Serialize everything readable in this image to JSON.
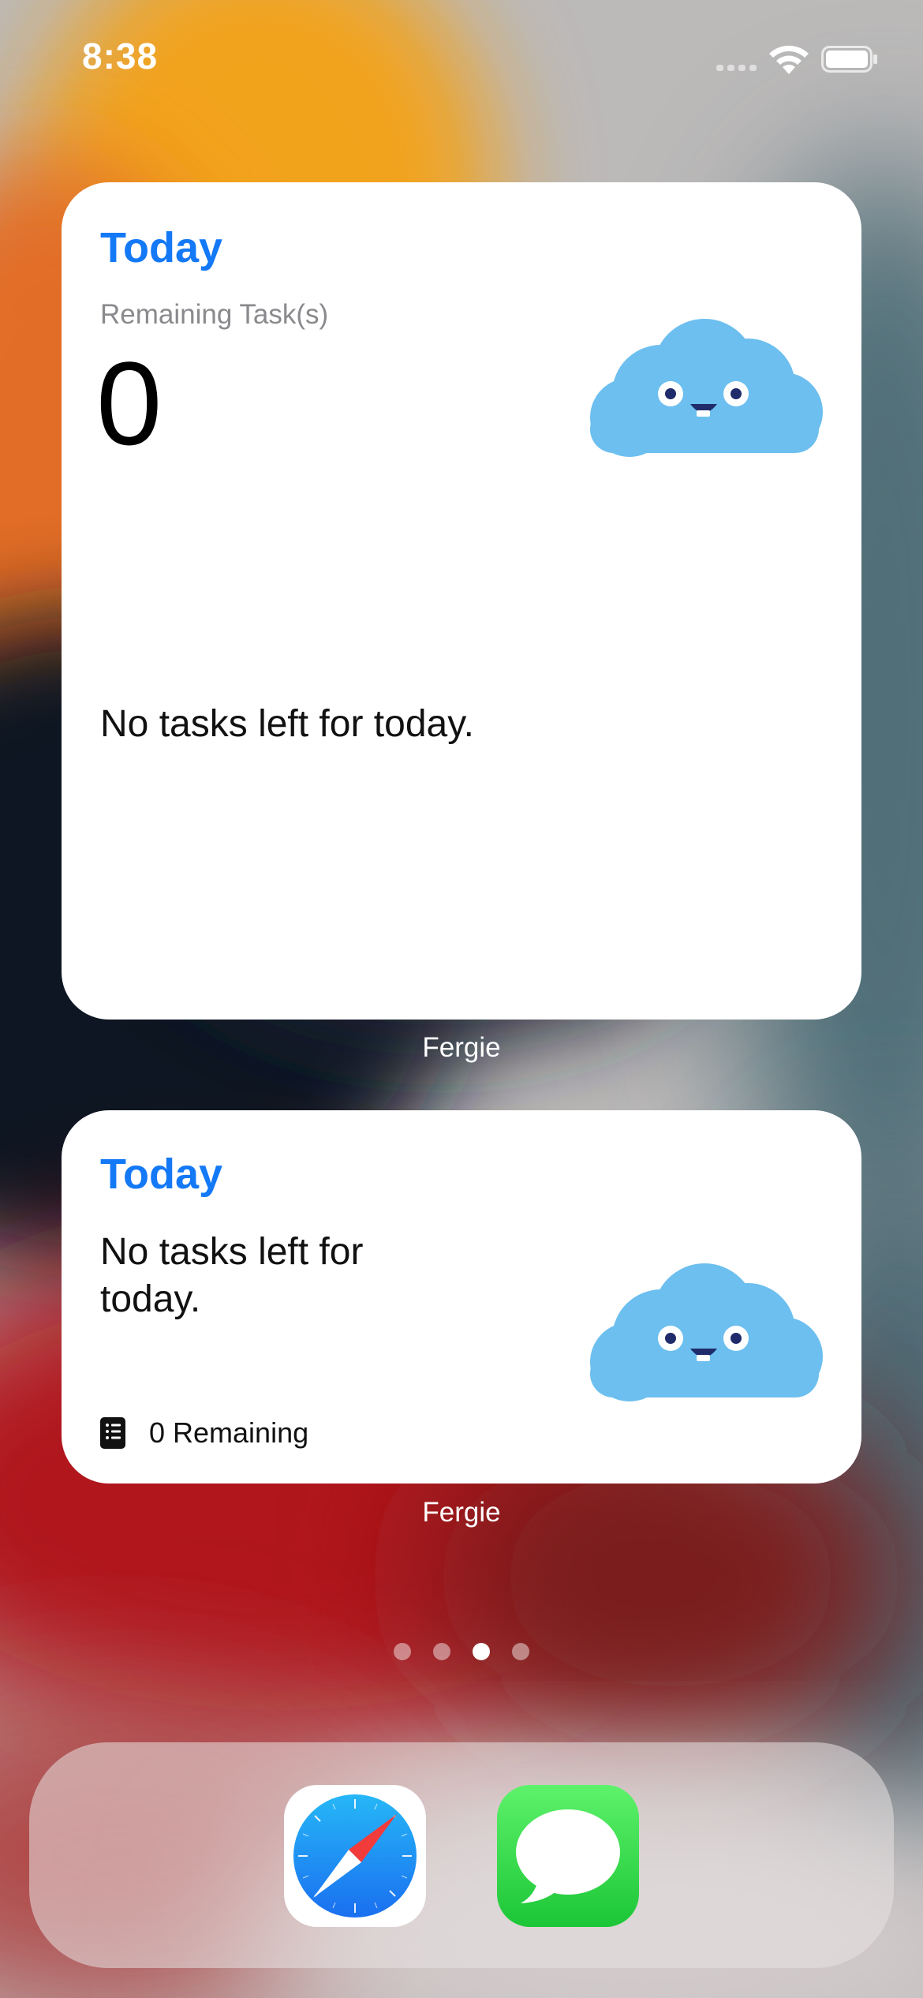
{
  "status_bar": {
    "time": "8:38"
  },
  "widgets": [
    {
      "title": "Today",
      "subtitle": "Remaining Task(s)",
      "count": "0",
      "message": "No tasks left for today.",
      "label": "Fergie",
      "mascot_icon": "cloud-mascot-icon"
    },
    {
      "title": "Today",
      "message": "No tasks left for today.",
      "remaining_text": "0 Remaining",
      "remaining_icon": "notebook-icon",
      "label": "Fergie",
      "mascot_icon": "cloud-mascot-icon"
    }
  ],
  "page_indicator": {
    "pages": 4,
    "current": 3
  },
  "dock": {
    "apps": [
      {
        "icon": "safari-icon"
      },
      {
        "icon": "messages-icon"
      }
    ]
  },
  "colors": {
    "widget_title": "#1479f6",
    "cloud": "#6cbfef",
    "safari_blue": "#1a8cf2",
    "messages_green": "#2fd94a"
  }
}
